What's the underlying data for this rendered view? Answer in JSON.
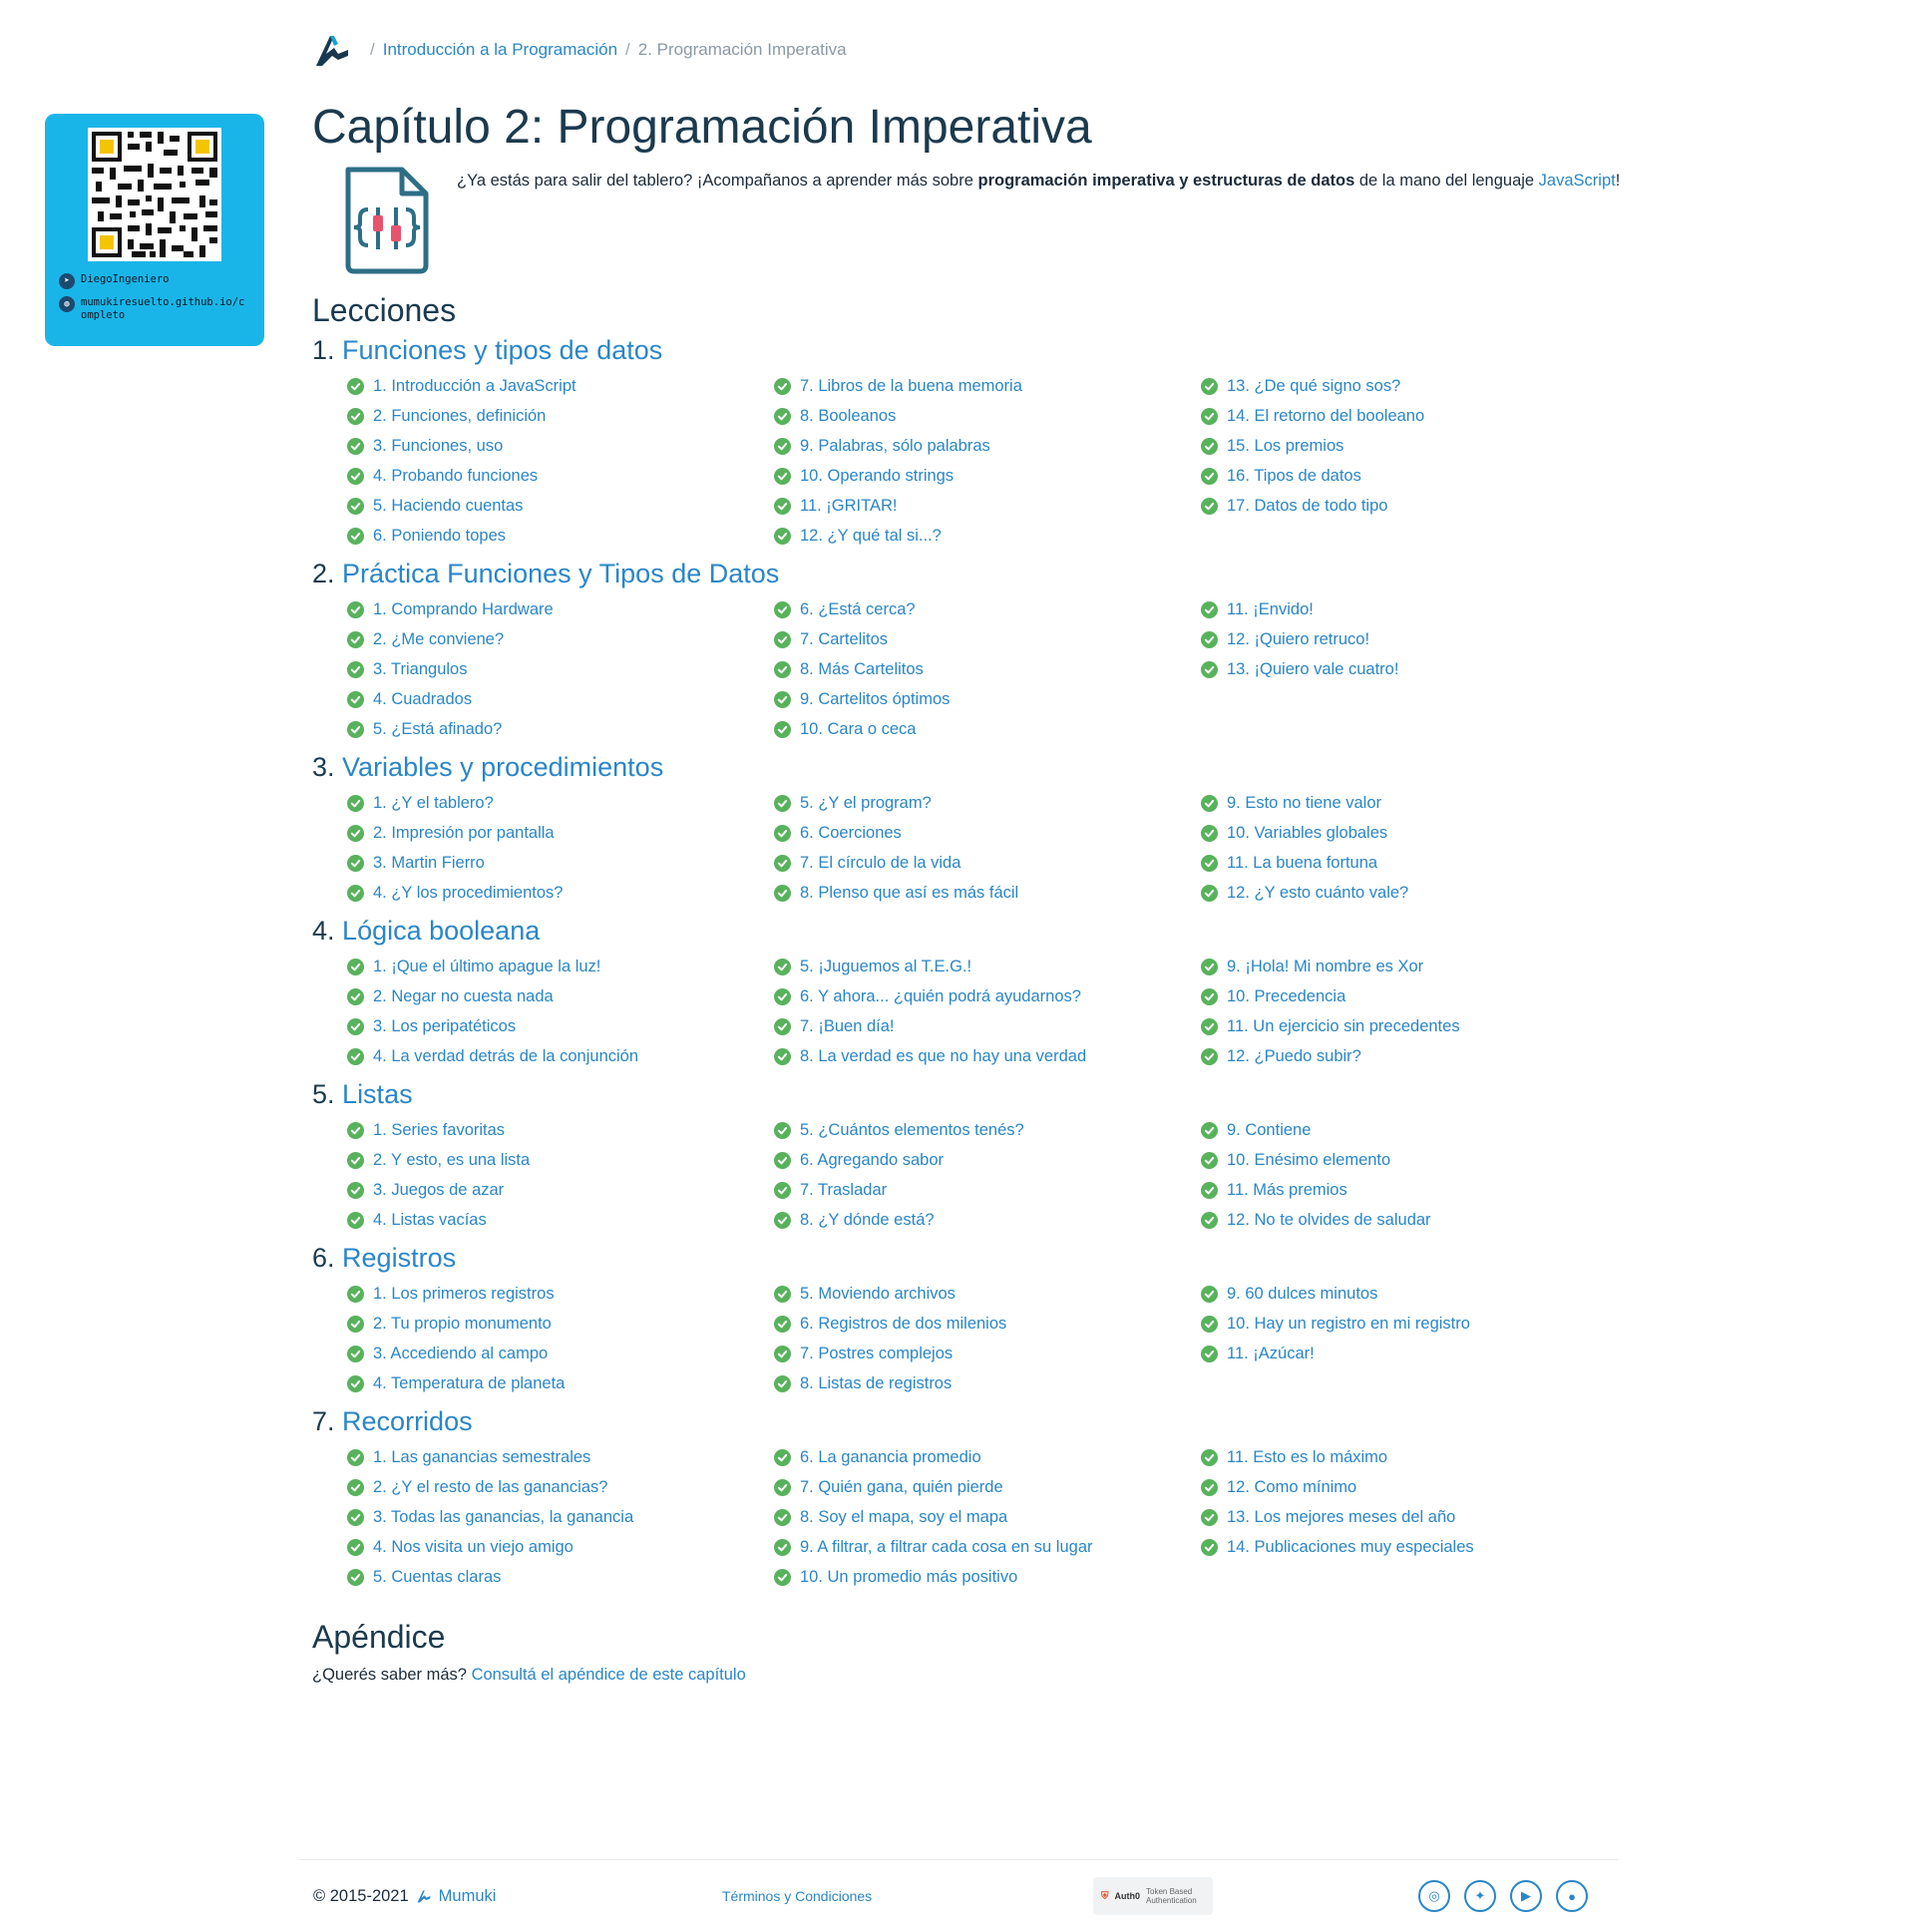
{
  "qr": {
    "telegram": "DiegoIngeniero",
    "website": "mumukiresuelto.github.io/completo"
  },
  "breadcrumb": {
    "course": "Introducción a la Programación",
    "current": "2. Programación Imperativa"
  },
  "chapter": {
    "title": "Capítulo 2: Programación Imperativa",
    "intro_pre": "¿Ya estás para salir del tablero? ¡Acompañanos a aprender más sobre ",
    "intro_bold": "programación imperativa y estructuras de datos",
    "intro_mid": " de la mano del lenguaje ",
    "intro_link": "JavaScript",
    "intro_post": "!"
  },
  "lessons_heading": "Lecciones",
  "lessons": [
    {
      "num": "1.",
      "title": "Funciones y tipos de datos",
      "columns": [
        [
          "1. Introducción a JavaScript",
          "2. Funciones, definición",
          "3. Funciones, uso",
          "4. Probando funciones",
          "5. Haciendo cuentas",
          "6. Poniendo topes"
        ],
        [
          "7. Libros de la buena memoria",
          "8. Booleanos",
          "9. Palabras, sólo palabras",
          "10. Operando strings",
          "11. ¡GRITAR!",
          "12. ¿Y qué tal si...?"
        ],
        [
          "13. ¿De qué signo sos?",
          "14. El retorno del booleano",
          "15. Los premios",
          "16. Tipos de datos",
          "17. Datos de todo tipo"
        ]
      ]
    },
    {
      "num": "2.",
      "title": "Práctica Funciones y Tipos de Datos",
      "columns": [
        [
          "1. Comprando Hardware",
          "2. ¿Me conviene?",
          "3. Triangulos",
          "4. Cuadrados",
          "5. ¿Está afinado?"
        ],
        [
          "6. ¿Está cerca?",
          "7. Cartelitos",
          "8. Más Cartelitos",
          "9. Cartelitos óptimos",
          "10. Cara o ceca"
        ],
        [
          "11. ¡Envido!",
          "12. ¡Quiero retruco!",
          "13. ¡Quiero vale cuatro!"
        ]
      ]
    },
    {
      "num": "3.",
      "title": "Variables y procedimientos",
      "columns": [
        [
          "1. ¿Y el tablero?",
          "2. Impresión por pantalla",
          "3. Martin Fierro",
          "4. ¿Y los procedimientos?"
        ],
        [
          "5. ¿Y el program?",
          "6. Coerciones",
          "7. El círculo de la vida",
          "8. Plenso que así es más fácil"
        ],
        [
          "9. Esto no tiene valor",
          "10. Variables globales",
          "11. La buena fortuna",
          "12. ¿Y esto cuánto vale?"
        ]
      ]
    },
    {
      "num": "4.",
      "title": "Lógica booleana",
      "columns": [
        [
          "1. ¡Que el último apague la luz!",
          "2. Negar no cuesta nada",
          "3. Los peripatéticos",
          "4. La verdad detrás de la conjunción"
        ],
        [
          "5. ¡Juguemos al T.E.G.!",
          "6. Y ahora... ¿quién podrá ayudarnos?",
          "7. ¡Buen día!",
          "8. La verdad es que no hay una verdad"
        ],
        [
          "9. ¡Hola! Mi nombre es Xor",
          "10. Precedencia",
          "11. Un ejercicio sin precedentes",
          "12. ¿Puedo subir?"
        ]
      ]
    },
    {
      "num": "5.",
      "title": "Listas",
      "columns": [
        [
          "1. Series favoritas",
          "2. Y esto, es una lista",
          "3. Juegos de azar",
          "4. Listas vacías"
        ],
        [
          "5. ¿Cuántos elementos tenés?",
          "6. Agregando sabor",
          "7. Trasladar",
          "8. ¿Y dónde está?"
        ],
        [
          "9. Contiene",
          "10. Enésimo elemento",
          "11. Más premios",
          "12. No te olvides de saludar"
        ]
      ]
    },
    {
      "num": "6.",
      "title": "Registros",
      "columns": [
        [
          "1. Los primeros registros",
          "2. Tu propio monumento",
          "3. Accediendo al campo",
          "4. Temperatura de planeta"
        ],
        [
          "5. Moviendo archivos",
          "6. Registros de dos milenios",
          "7. Postres complejos",
          "8. Listas de registros"
        ],
        [
          "9. 60 dulces minutos",
          "10. Hay un registro en mi registro",
          "11. ¡Azúcar!"
        ]
      ]
    },
    {
      "num": "7.",
      "title": "Recorridos",
      "columns": [
        [
          "1. Las ganancias semestrales",
          "2. ¿Y el resto de las ganancias?",
          "3. Todas las ganancias, la ganancia",
          "4. Nos visita un viejo amigo",
          "5. Cuentas claras"
        ],
        [
          "6. La ganancia promedio",
          "7. Quién gana, quién pierde",
          "8. Soy el mapa, soy el mapa",
          "9. A filtrar, a filtrar cada cosa en su lugar",
          "10. Un promedio más positivo"
        ],
        [
          "11. Esto es lo máximo",
          "12. Como mínimo",
          "13. Los mejores meses del año",
          "14. Publicaciones muy especiales"
        ]
      ]
    }
  ],
  "appendix": {
    "heading": "Apéndice",
    "question": "¿Querés saber más?",
    "link": "Consultá el apéndice de este capítulo"
  },
  "footer": {
    "copyright": "© 2015-2021",
    "brand": "Mumuki",
    "terms": "Términos y Condiciones",
    "auth0_brand": "Auth0",
    "auth0_caption": "Token Based Authentication",
    "social": [
      "instagram-icon",
      "twitter-icon",
      "youtube-icon",
      "github-icon"
    ]
  },
  "colors": {
    "link": "#2a86c8",
    "check": "#58b25c",
    "heading": "#1b3a4e",
    "qr_card": "#1ab5e8"
  }
}
